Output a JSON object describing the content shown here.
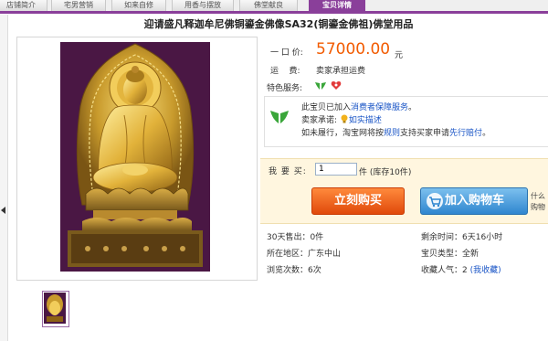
{
  "tabs": [
    {
      "label": "店铺简介"
    },
    {
      "label": "宅男营销"
    },
    {
      "label": "如来自修"
    },
    {
      "label": "用香与摆放"
    },
    {
      "label": "佛堂献良"
    },
    {
      "label": "宝贝详情"
    }
  ],
  "title": "迎请盛凡释迦牟尼佛铜鎏金佛像SA32(铜鎏金佛祖)佛堂用品",
  "info": {
    "price_label": "一 口 价:",
    "price": "57000.00",
    "price_unit": "元",
    "shipping_label": "运    费:",
    "shipping_value": "卖家承担运费",
    "service_label": "特色服务:"
  },
  "guarantee": {
    "line1_pre": "此宝贝已加入",
    "line1_link": "消费者保障服务",
    "line1_post": "。",
    "line2_pre": "卖家承诺:",
    "line2_link": "如实描述",
    "line3_pre": "如未履行，淘宝网将按",
    "line3_link1": "规则",
    "line3_mid": "支持买家申请",
    "line3_link2": "先行赔付",
    "line3_post": "。"
  },
  "buy": {
    "qty_label": "我 要 买:",
    "qty_value": "1",
    "qty_unit": "件  (库存10件)",
    "buy_now": "立刻购买",
    "add_cart": "加入购物车",
    "side_note": "什么\n购物"
  },
  "stats": {
    "sold_30d": "30天售出：0件",
    "time_left": "剩余时间：6天16小时",
    "location": "所在地区：广东中山",
    "item_type": "宝贝类型：全新",
    "views": "浏览次数：6次",
    "favorites_pre": "收藏人气：2",
    "favorites_link": "(我收藏)"
  },
  "colors": {
    "accent": "#8a3f9a",
    "price": "#f25b00",
    "link": "#1a55c6"
  }
}
